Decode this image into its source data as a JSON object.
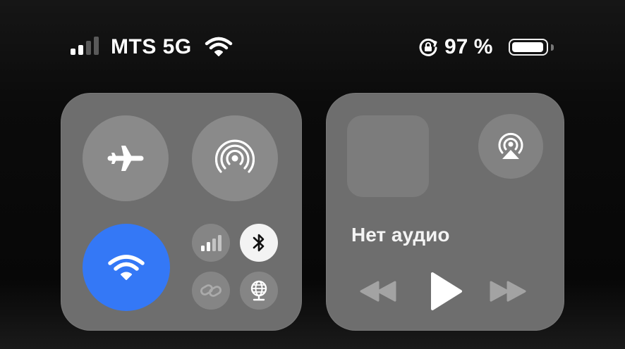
{
  "status_bar": {
    "carrier": "MTS 5G",
    "signal_bars_active": 2,
    "signal_bars_total": 4,
    "battery_text": "97 %",
    "battery_level": 0.97
  },
  "connectivity": {
    "airplane_mode": {
      "icon": "airplane-icon",
      "active": false
    },
    "personal_hotspot": {
      "icon": "hotspot-icon",
      "active": false
    },
    "wifi": {
      "icon": "wifi-icon",
      "active": true,
      "color": "#3478f6"
    },
    "cellular": {
      "icon": "cellular-icon",
      "active": false
    },
    "bluetooth": {
      "icon": "bluetooth-icon",
      "active": true
    },
    "vpn": {
      "icon": "vpn-icon",
      "active": false
    },
    "globe": {
      "icon": "globe-icon",
      "active": false
    }
  },
  "now_playing": {
    "label": "Нет аудио",
    "airplay_icon": "airplay-icon"
  },
  "colors": {
    "panel": "#6e6e6e",
    "wifi_active": "#3478f6",
    "bluetooth_active_bg": "#f3f3f3"
  }
}
